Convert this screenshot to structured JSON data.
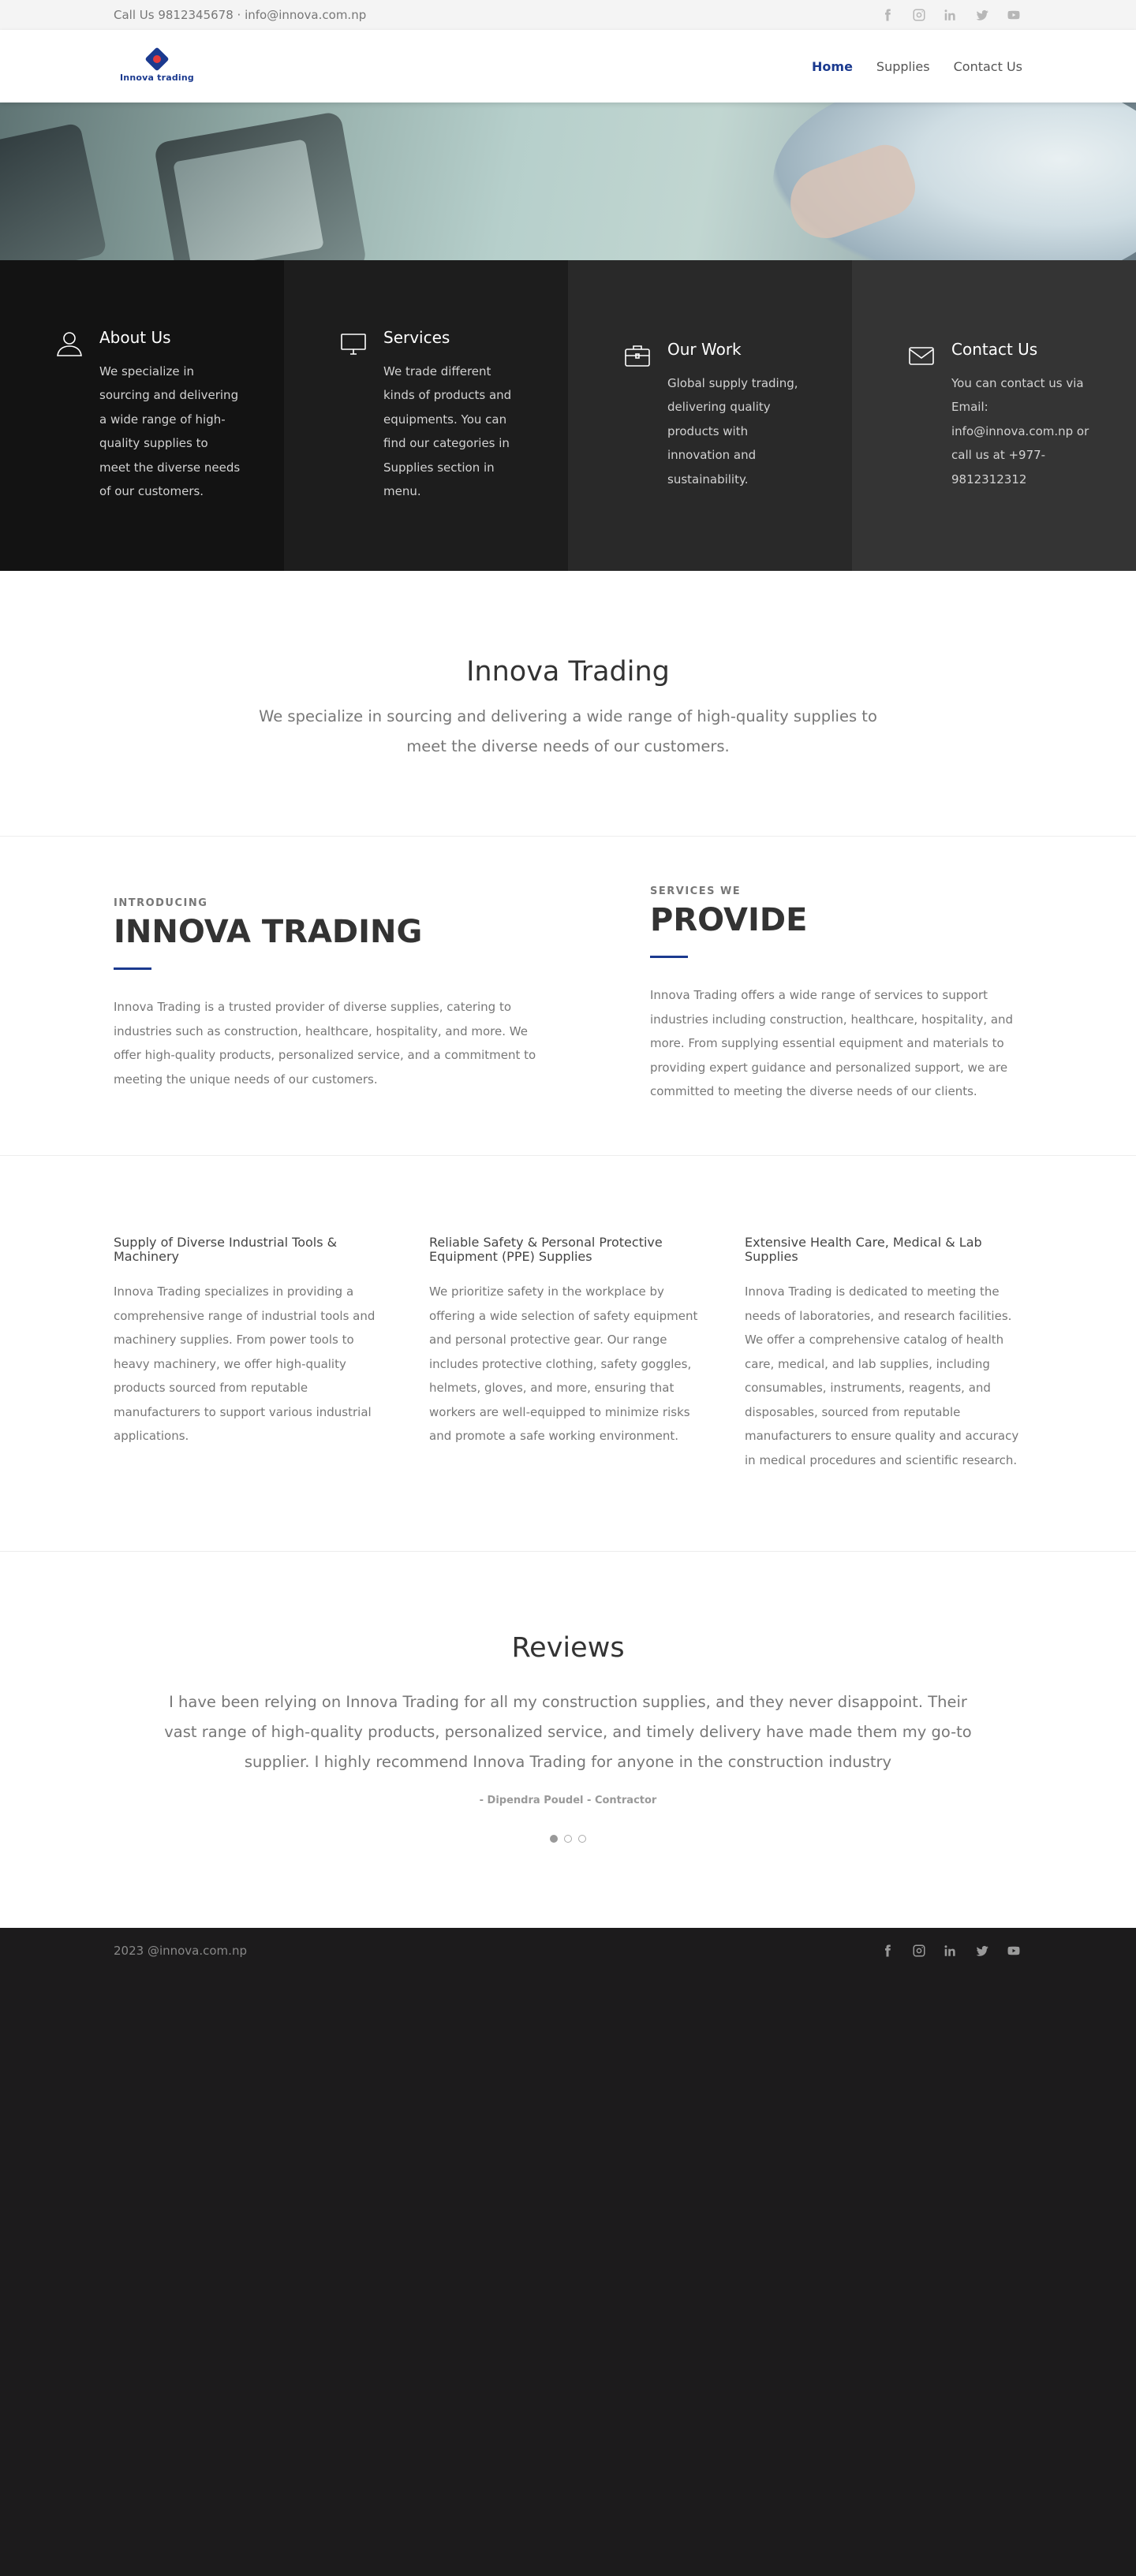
{
  "topbar": {
    "contact": "Call Us 9812345678 · info@innova.com.np"
  },
  "socials": [
    {
      "icon": "facebook-icon"
    },
    {
      "icon": "instagram-icon"
    },
    {
      "icon": "linkedin-icon"
    },
    {
      "icon": "twitter-icon"
    },
    {
      "icon": "youtube-icon"
    }
  ],
  "header": {
    "logo_text": "Innova trading",
    "nav": [
      {
        "label": "Home",
        "active": true
      },
      {
        "label": "Supplies",
        "active": false
      },
      {
        "label": "Contact Us",
        "active": false
      }
    ]
  },
  "features": [
    {
      "icon": "user-icon",
      "title": "About Us",
      "text": "We specialize in sourcing and delivering a wide range of high-quality supplies to meet the diverse needs of our customers."
    },
    {
      "icon": "monitor-icon",
      "title": "Services",
      "text": "We trade different kinds of products and equipments. You can find our categories in Supplies section in menu."
    },
    {
      "icon": "briefcase-icon",
      "title": "Our Work",
      "text": "Global supply trading, delivering quality products with innovation and sustainability."
    },
    {
      "icon": "envelope-icon",
      "title": "Contact Us",
      "text": "You can contact us via Email: info@innova.com.np or call us at +977-9812312312"
    }
  ],
  "intro": {
    "title": "Innova Trading",
    "text": "We specialize in sourcing and delivering a wide range of high-quality supplies to meet the diverse needs of our customers."
  },
  "about": {
    "left": {
      "eyebrow": "INTRODUCING",
      "title": "INNOVA TRADING",
      "text": "Innova Trading is a trusted provider of diverse supplies, catering to industries such as construction, healthcare, hospitality, and more. We offer high-quality products, personalized service, and a commitment to meeting the unique needs of our customers."
    },
    "right": {
      "eyebrow": "SERVICES WE",
      "title": "PROVIDE",
      "text": "Innova Trading offers a wide range of services to support industries including construction, healthcare, hospitality, and more. From supplying essential equipment and materials to providing expert guidance and personalized support, we are committed to meeting the diverse needs of our clients."
    }
  },
  "services": [
    {
      "title": "Supply of Diverse Industrial Tools & Machinery",
      "text": "Innova Trading specializes in providing a comprehensive range of industrial tools and machinery supplies. From power tools to heavy machinery, we offer high-quality products sourced from reputable manufacturers to support various industrial applications."
    },
    {
      "title": "Reliable Safety & Personal Protective Equipment (PPE) Supplies",
      "text": "We prioritize safety in the workplace by offering a wide selection of safety equipment and personal protective gear. Our range includes protective clothing, safety goggles, helmets, gloves, and more, ensuring that workers are well-equipped to minimize risks and promote a safe working environment."
    },
    {
      "title": "Extensive Health Care, Medical & Lab Supplies",
      "text": "Innova Trading is dedicated to meeting the needs of laboratories, and research facilities. We offer a comprehensive catalog of health care, medical, and lab supplies, including consumables, instruments, reagents, and disposables, sourced from reputable manufacturers to ensure quality and accuracy in medical procedures and scientific research."
    }
  ],
  "reviews": {
    "title": "Reviews",
    "quote": "I have been relying on Innova Trading for all my construction supplies, and they never disappoint. Their vast range of high-quality products, personalized service, and timely delivery have made them my go-to supplier. I highly recommend Innova Trading for anyone in the construction industry",
    "author": "- Dipendra Poudel - Contractor",
    "slides": 3,
    "active_slide": 1
  },
  "footer": {
    "copyright": "2023 @innova.com.np"
  },
  "colors": {
    "accent": "#1b3a8f",
    "footer_bg": "#1c1b1c"
  }
}
